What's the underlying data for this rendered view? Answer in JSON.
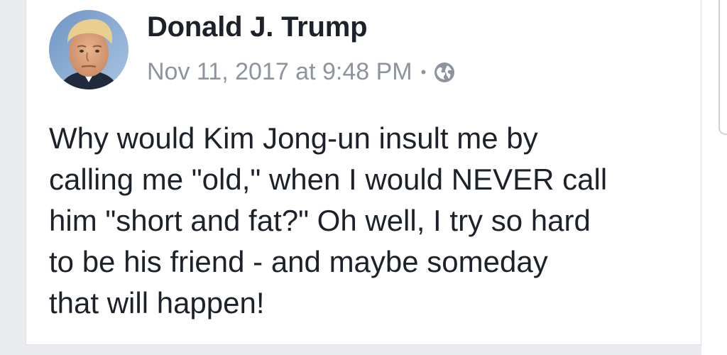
{
  "post": {
    "author": "Donald J. Trump",
    "timestamp": "Nov 11, 2017 at 9:48 PM",
    "separator": "•",
    "privacy_icon": "globe-icon",
    "text_lines": [
      "Why would Kim Jong-un insult me by",
      "calling me \"old,\" when I would NEVER call",
      "him \"short and fat?\" Oh well, I try so hard",
      "to be his friend - and maybe someday",
      "that will happen!"
    ]
  },
  "colors": {
    "author": "#1d2129",
    "meta": "#8d949e",
    "background": "#e9ebee"
  }
}
